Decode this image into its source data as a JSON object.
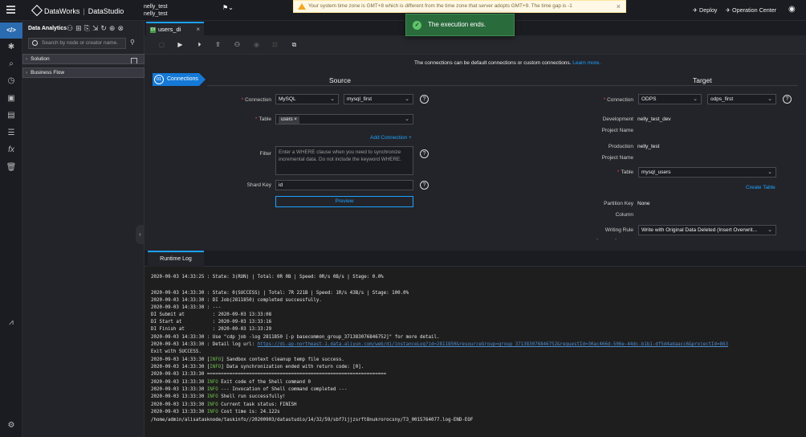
{
  "topbar": {
    "brand": "DataWorks",
    "module": "DataStudio",
    "user_line1": "nelly_test",
    "user_line2": "nelly_test",
    "warning": "Your system time zone is GMT+8 which is different from the time zone that server adopts GMT+9. The time gap is -1",
    "deploy": "Deploy",
    "operation_center": "Operation Center"
  },
  "toast": {
    "message": "The execution ends."
  },
  "sidebar": {
    "title": "Data Analytics",
    "search_placeholder": "Search by node or creator name.",
    "items": [
      {
        "label": "Solution"
      },
      {
        "label": "Business Flow"
      }
    ]
  },
  "tab": {
    "label": "users_di",
    "badge": "DI"
  },
  "content": {
    "note": "The connections can be default connections or custom connections.",
    "learn_more": "Learn more.",
    "step_number": "01",
    "step_label": "Connections",
    "source": {
      "header": "Source",
      "connection_label": "Connection",
      "connection_type": "MySQL",
      "connection_name": "mysql_first",
      "table_label": "Table",
      "table_chip": "users",
      "add_connection": "Add Connection +",
      "filter_label": "Filter",
      "filter_placeholder": "Enter a WHERE clause when you need to synchronize incremental data. Do not include the keyword WHERE.",
      "shard_label": "Shard Key",
      "shard_value": "id",
      "preview": "Preview"
    },
    "target": {
      "header": "Target",
      "connection_label": "Connection",
      "connection_type": "ODPS",
      "connection_name": "odps_first",
      "dev_label_1": "Development",
      "dev_label_2": "Project Name",
      "dev_value": "nelly_test_dev",
      "prod_label_1": "Production",
      "prod_label_2": "Project Name",
      "prod_value": "nelly_test",
      "table_label": "Table",
      "table_value": "mysql_users",
      "create_table": "Create Table",
      "partition_label_1": "Partition Key",
      "partition_label_2": "Column",
      "partition_value": "None",
      "writing_rule_label": "Writing Rule",
      "writing_rule_value": "Write with Original Data Deleted (Insert Overwrit...",
      "dash": "-"
    }
  },
  "log": {
    "tab": "Runtime Log",
    "lines": [
      [
        "2020-09-03 14:33:25 : State: 3(RUN) | Total: 0R 0B | Speed: 0R/s 0B/s | Stage: 0.0%"
      ],
      [
        "2020-09-03 14:33:30 : State: 0(SUCCESS) | Total: 7R 221B | Speed: 1R/s 43B/s | Stage: 100.0%"
      ],
      [
        "2020-09-03 14:33:30 : DI Job(2811850) completed successfully."
      ],
      [
        "2020-09-03 14:33:30 : ---"
      ],
      [
        "DI Submit at          : 2020-09-03 13:33:08"
      ],
      [
        "DI Start at           : 2020-09-03 13:33:16"
      ],
      [
        "DI Finish at          : 2020-09-03 13:33:29"
      ],
      [
        "2020-09-03 14:33:30 : Use \"cdp job -log 2811850 [-p basecommon_group_371383076846752]\" for more detail."
      ],
      [
        "2020-09-03 14:33:30 : Detail log url: ",
        "https://di-ap-northeast-1.data.aliyun.com/web/di/instanceLog?id=2811850&resourceGroup=group_371383076846752&requestId=30ac466d-506e-44dc-b1b1-df5d4adaacc6&projectId=863"
      ],
      [
        "Exit with SUCCESS."
      ],
      [
        "2020-09-03 14:33:30 [",
        "INFO",
        "] Sandbox context cleanup temp file success."
      ],
      [
        "2020-09-03 14:33:30 [",
        "INFO",
        "] Data synchronization ended with return code: [0]."
      ],
      [
        "2020-09-03 13:33:30 ================================================================"
      ],
      [
        "2020-09-03 13:33:30 ",
        "INFO",
        " Exit code of the Shell command 0"
      ],
      [
        "2020-09-03 13:33:30 ",
        "INFO",
        " --- Invocation of Shell command completed ---"
      ],
      [
        "2020-09-03 13:33:30 ",
        "INFO",
        " Shell run successfully!"
      ],
      [
        "2020-09-03 13:33:30 ",
        "INFO",
        " Current task status: FINISH"
      ],
      [
        "2020-09-03 13:33:30 ",
        "INFO",
        " Cost time is: 24.122s"
      ],
      [
        "/home/admin/alisatasknode/taskinfo//20200903/datastudio/14/32/59/sbf7ijjzsrft8nukrorocsny/T3_0015764077.log-END-EOF"
      ]
    ]
  },
  "colors": {
    "accent": "#1da1ff",
    "success": "#2a6b3c",
    "required": "#e0443b",
    "warning_bg": "#fff8e6"
  }
}
